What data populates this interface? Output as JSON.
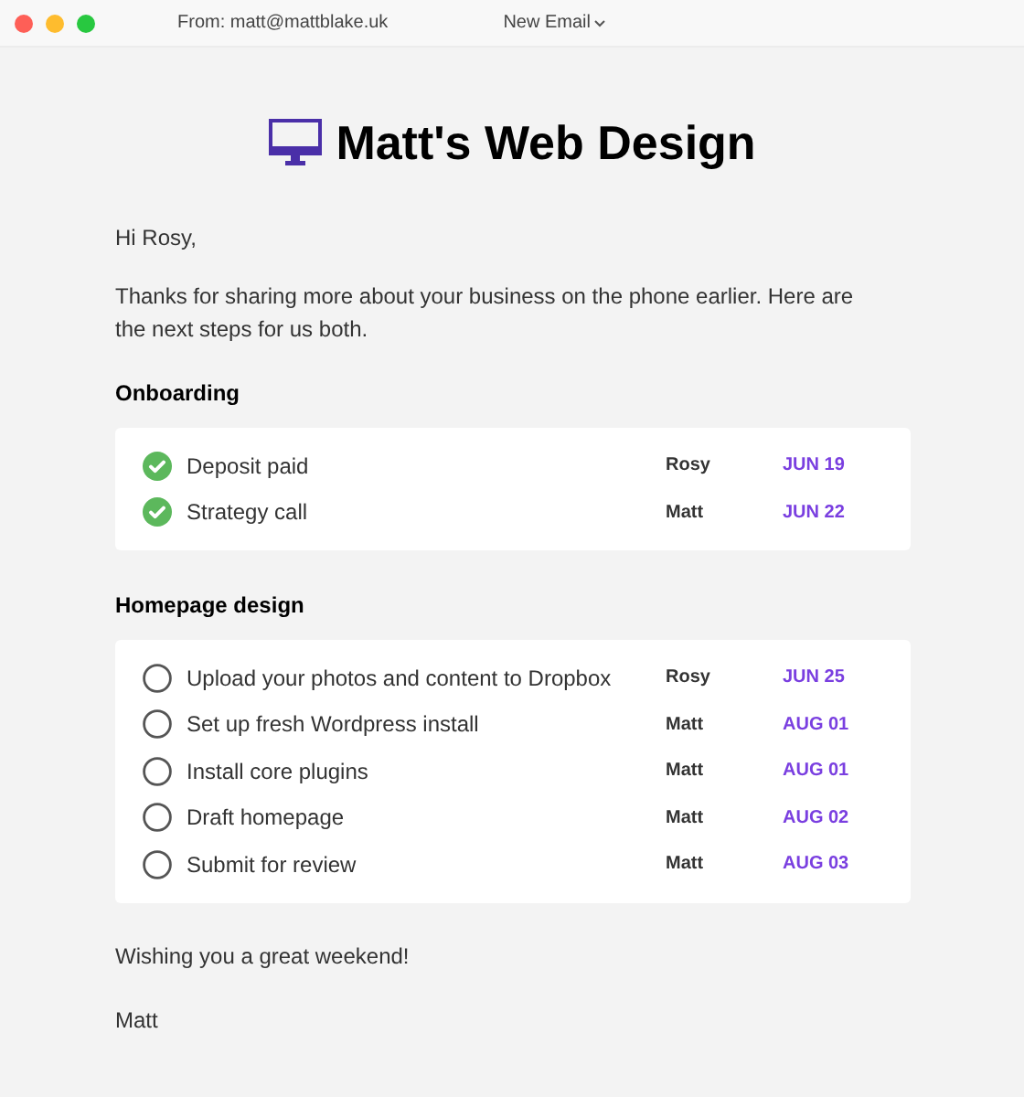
{
  "toolbar": {
    "from": "From: matt@mattblake.uk",
    "title": "New Email"
  },
  "email": {
    "heading": "Matt's Web Design",
    "greeting": "Hi Rosy,",
    "intro": "Thanks for sharing more about your business on the phone earlier. Here are the next steps for us both.",
    "sections": [
      {
        "title": "Onboarding",
        "tasks": [
          {
            "label": "Deposit paid",
            "owner": "Rosy",
            "date": "JUN 19",
            "checked": true
          },
          {
            "label": "Strategy call",
            "owner": "Matt",
            "date": "JUN 22",
            "checked": true
          }
        ]
      },
      {
        "title": "Homepage design",
        "tasks": [
          {
            "label": "Upload your photos and content to Dropbox",
            "owner": "Rosy",
            "date": "JUN 25",
            "checked": false
          },
          {
            "label": "Set up fresh Wordpress install",
            "owner": "Matt",
            "date": "AUG 01",
            "checked": false
          },
          {
            "label": "Install core plugins",
            "owner": "Matt",
            "date": "AUG 01",
            "checked": false
          },
          {
            "label": "Draft homepage",
            "owner": "Matt",
            "date": "AUG 02",
            "checked": false
          },
          {
            "label": "Submit for review",
            "owner": "Matt",
            "date": "AUG 03",
            "checked": false
          }
        ]
      }
    ],
    "closing": "Wishing you a great weekend!",
    "signature": "Matt"
  }
}
